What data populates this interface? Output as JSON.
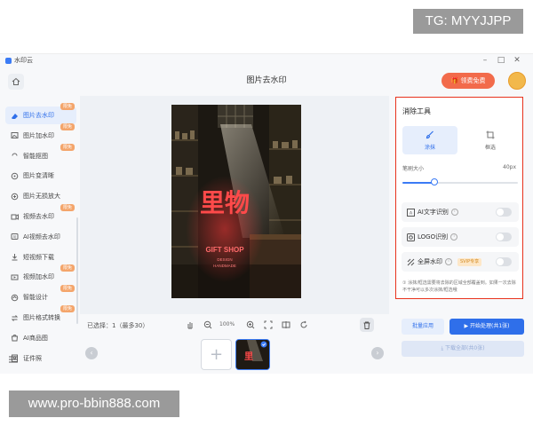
{
  "overlays": {
    "top": "TG: MYYJJPP",
    "bottom": "www.pro-bbin888.com"
  },
  "app": {
    "name": "水印云"
  },
  "header": {
    "title": "图片去水印",
    "vip_button": "领费免费"
  },
  "sidebar": {
    "items": [
      {
        "label": "图片去水印",
        "badge": "限免",
        "icon": "eraser-icon",
        "active": true
      },
      {
        "label": "图片加水印",
        "badge": "限免",
        "icon": "image-stamp-icon"
      },
      {
        "label": "智能抠图",
        "badge": "限免",
        "icon": "cutout-icon"
      },
      {
        "label": "图片变清晰",
        "badge": "",
        "icon": "enhance-icon"
      },
      {
        "label": "图片无损放大",
        "badge": "",
        "icon": "zoom-image-icon"
      },
      {
        "label": "视频去水印",
        "badge": "限免",
        "icon": "video-eraser-icon"
      },
      {
        "label": "AI视频去水印",
        "badge": "",
        "icon": "ai-video-icon"
      },
      {
        "label": "短视频下载",
        "badge": "",
        "icon": "download-video-icon"
      },
      {
        "label": "视频加水印",
        "badge": "限免",
        "icon": "video-stamp-icon"
      },
      {
        "label": "智能设计",
        "badge": "限免",
        "icon": "design-icon"
      },
      {
        "label": "图片格式转换",
        "badge": "限免",
        "icon": "convert-icon"
      },
      {
        "label": "AI商品图",
        "badge": "",
        "icon": "product-icon"
      },
      {
        "label": "证件照",
        "badge": "",
        "icon": "id-photo-icon"
      }
    ]
  },
  "canvas": {
    "sign_text": "里物",
    "shop_text": "GIFT SHOP",
    "shop_sub1": "DESIGN",
    "shop_sub2": "HANDMADE",
    "selected_label": "已选择：1（最多30）",
    "zoom": "100%"
  },
  "panel": {
    "title": "消除工具",
    "tool_brush": "涂抹",
    "tool_box": "框选",
    "brush_size_label": "笔刷大小",
    "brush_size_value": "40px",
    "brush_level": 0.28,
    "options": [
      {
        "label": "AI文字识别",
        "icon": "ai-text-icon",
        "enabled": false
      },
      {
        "label": "LOGO识别",
        "icon": "logo-scan-icon",
        "enabled": false
      },
      {
        "label": "全屏水印",
        "icon": "fullscreen-watermark-icon",
        "tag": "SVIP专享",
        "enabled": false
      }
    ],
    "note": "① 涂抹/框选需要将去除的区域全部覆盖到。如果一次去除不干净可以多次涂抹/框选哦"
  },
  "actions": {
    "batch": "批量应用",
    "start": "开始处理(共1张)",
    "download": "下载全部(共0张)"
  },
  "colors": {
    "accent": "#2f6fea",
    "highlight_border": "#e8321c",
    "vip": "#f26b4b"
  }
}
